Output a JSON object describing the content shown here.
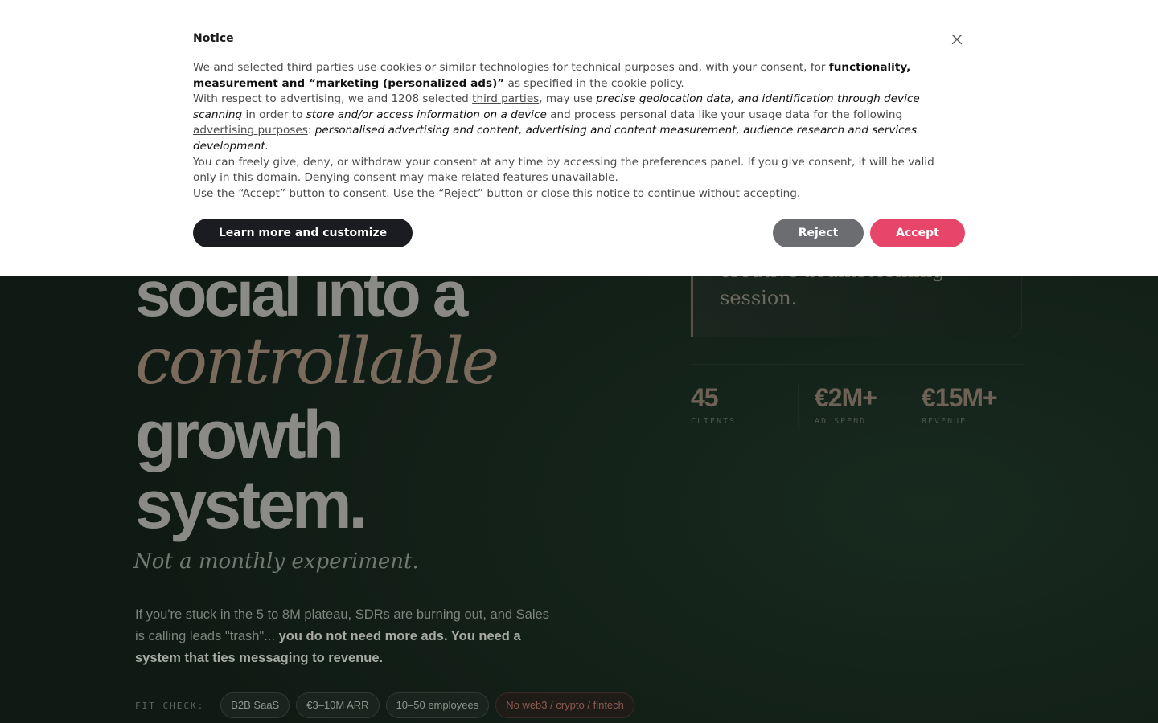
{
  "notice": {
    "title": "Notice",
    "p1": {
      "t1": "We and selected third parties use cookies or similar technologies for technical purposes and, with your consent, for ",
      "b1": "functionality, measurement and “marketing (personalized ads)”",
      "t2": " as specified in the ",
      "link_cookie": "cookie policy",
      "t3": "."
    },
    "p2": {
      "t1": "With respect to advertising, we and 1208 selected ",
      "link_third": "third parties",
      "t2": ", may use ",
      "e1": "precise geolocation data, and identification through device scanning",
      "t3": " in order to ",
      "e2": "store and/or access information on a device",
      "t4": " and process personal data like your usage data for the following ",
      "link_ads": "advertising purposes",
      "t5": ": ",
      "e3": "personalised advertising and content, advertising and content measurement, audience research and services development."
    },
    "p3": "You can freely give, deny, or withdraw your consent at any time by accessing the preferences panel. If you give consent, it will be valid only in this domain. Denying consent may make related features unavailable.",
    "p4": "Use the “Accept” button to consent. Use the “Reject” button or close this notice to continue without accepting.",
    "customize_label": "Learn more and customize",
    "reject_label": "Reject",
    "accept_label": "Accept",
    "close_icon": "close-icon",
    "accept_color": "#e8456a",
    "reject_color": "#6b6d70",
    "customize_color": "#1b1c22"
  },
  "hero": {
    "line1": "social into a",
    "line2": "controllable",
    "line3": "growth",
    "line4": "system.",
    "tagline": "Not a monthly experiment.",
    "intro_plain": "If you're stuck in the 5 to 8M plateau, SDRs are burning out, and Sales is calling leads \"trash\"... ",
    "intro_bold": "you do not need more ads. You need a system that ties messaging to revenue."
  },
  "fit_check": {
    "label": "FIT CHECK:",
    "chips": [
      "B2B SaaS",
      "€3–10M ARR",
      "10–50 employees"
    ],
    "negative_chip": "No web3 / crypto / fintech"
  },
  "quote": {
    "text": "creative brainstorming session."
  },
  "stats": [
    {
      "value": "45",
      "label": "CLIENTS"
    },
    {
      "value": "€2M+",
      "label": "AD SPEND"
    },
    {
      "value": "€15M+",
      "label": "REVENUE"
    }
  ]
}
